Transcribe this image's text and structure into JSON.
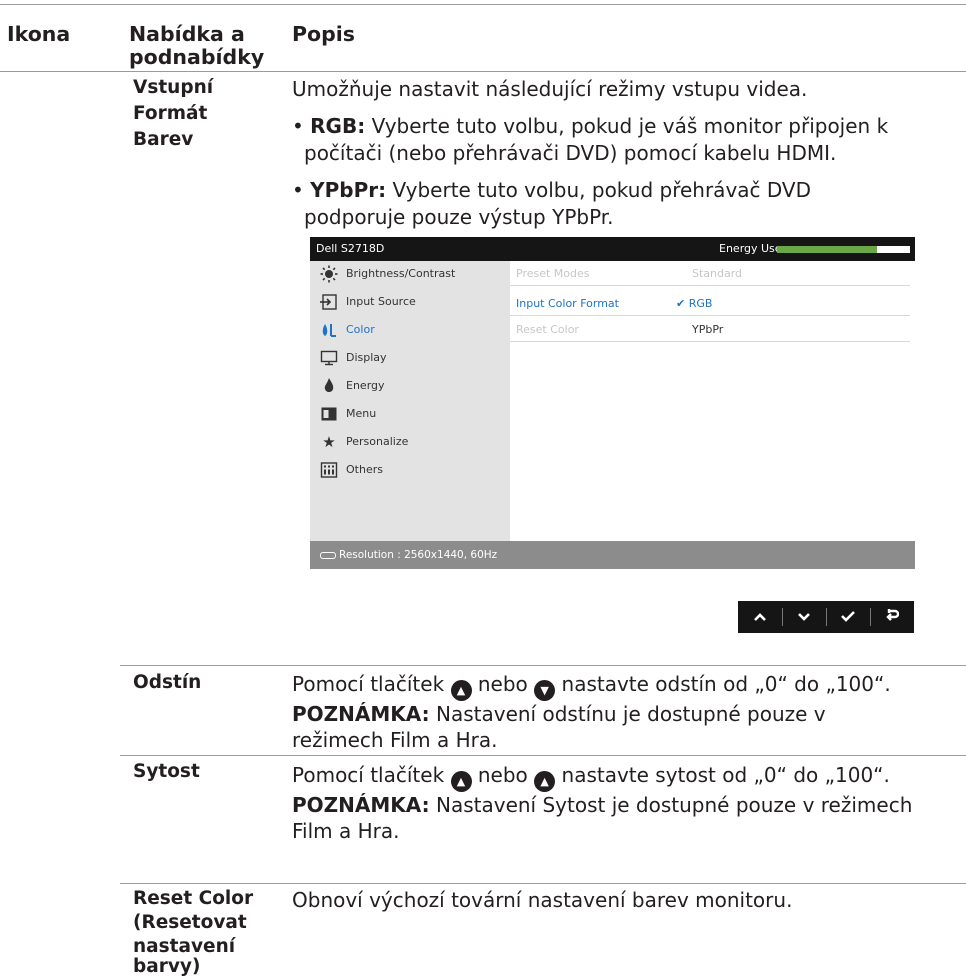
{
  "header": {
    "col1": "Ikona",
    "col2_line1": "Nabídka a",
    "col2_line2": "podnabídky",
    "col3": "Popis"
  },
  "section_input_format": {
    "label_line1": "Vstupní",
    "label_line2": "Formát",
    "label_line3": "Barev",
    "intro": "Umožňuje nastavit následující režimy vstupu videa.",
    "rgb_term": "RGB:",
    "rgb_text_line1": " Vyberte tuto volbu, pokud je váš monitor připojen k",
    "rgb_text_line2": "počítači (nebo přehrávači DVD) pomocí kabelu HDMI.",
    "ypbpr_term": "YPbPr:",
    "ypbpr_text_line1": " Vyberte tuto volbu, pokud přehrávač DVD",
    "ypbpr_text_line2": "podporuje pouze výstup YPbPr."
  },
  "osd": {
    "title": "Dell S2718D",
    "energy_label": "Energy Use",
    "energy_level_percent": 75,
    "menu": [
      {
        "label": "Brightness/Contrast",
        "icon": "sun-icon"
      },
      {
        "label": "Input Source",
        "icon": "input-icon"
      },
      {
        "label": "Color",
        "icon": "color-icon"
      },
      {
        "label": "Display",
        "icon": "monitor-icon"
      },
      {
        "label": "Energy",
        "icon": "flame-icon"
      },
      {
        "label": "Menu",
        "icon": "menu-icon"
      },
      {
        "label": "Personalize",
        "icon": "star-icon"
      },
      {
        "label": "Others",
        "icon": "others-icon"
      }
    ],
    "rows": [
      {
        "label": "Preset Modes",
        "value": "Standard"
      },
      {
        "label": "Input Color Format",
        "value": "RGB",
        "check": "✔"
      },
      {
        "label": "Reset Color",
        "value": "YPbPr"
      }
    ],
    "resolution": "Resolution : 2560x1440, 60Hz",
    "accent_color": "#1c73c7",
    "energy_color": "#6aa747"
  },
  "nav_buttons": [
    "up",
    "down",
    "ok",
    "back"
  ],
  "section_hue": {
    "label": "Odstín",
    "text_a": "Pomocí tlačítek ",
    "text_b": " nebo ",
    "text_c": " nastavte odstín od „0“ do „100“.",
    "note_term": "POZNÁMKA:",
    "note_line1": " Nastavení odstínu je dostupné pouze v",
    "note_line2": "režimech Film a Hra."
  },
  "section_saturation": {
    "label": "Sytost",
    "text_a": "Pomocí tlačítek ",
    "text_b": " nebo ",
    "text_c": " nastavte sytost od „0“ do „100“.",
    "note_term": "POZNÁMKA:",
    "note_line1": " Nastavení Sytost je dostupné pouze v režimech",
    "note_line2": "Film a Hra."
  },
  "section_reset": {
    "label_line1": "Reset Color",
    "label_line2": "(Resetovat",
    "label_line3": "nastavení",
    "label_line4": "barvy)",
    "text": "Obnoví výchozí tovární nastavení barev monitoru."
  }
}
